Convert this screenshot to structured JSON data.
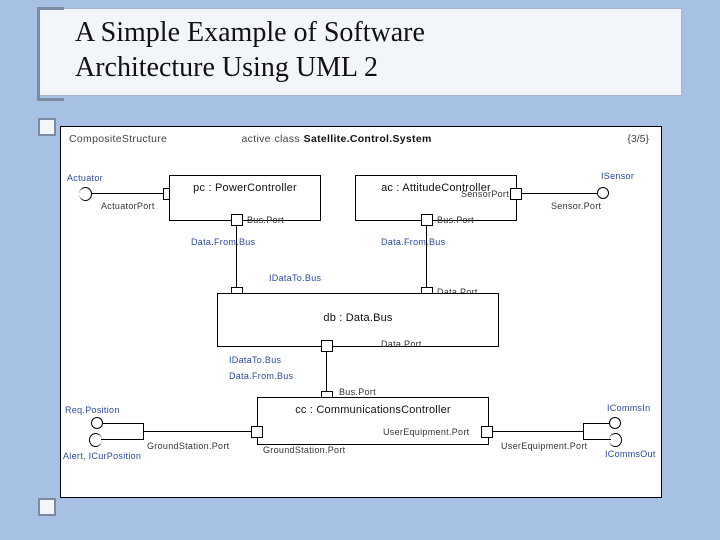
{
  "title_line1": "A Simple Example of Software",
  "title_line2": "Architecture Using UML 2",
  "header": {
    "left": "CompositeStructure",
    "middle_prefix": "active class",
    "middle_class": "Satellite.Control.System",
    "page": "{3/5}"
  },
  "components": {
    "pc": {
      "name": "pc : PowerController"
    },
    "ac": {
      "name": "ac : AttitudeController"
    },
    "db": {
      "name": "db : Data.Bus"
    },
    "cc": {
      "name": "cc : CommunicationsController"
    }
  },
  "labels": {
    "actuator": "Actuator",
    "isensor": "ISensor",
    "actuatorPortL": "ActuatorPort",
    "actuatorPortR": "ActuatorPort",
    "sensorPortL": "SensorPort",
    "sensorPortR": "Sensor.Port",
    "busPort": "Bus.Port",
    "dataFromBus": "Data.From.Bus",
    "idataToBus": "IDataTo.Bus",
    "dataPort": "Data.Port",
    "reqPosition": "Req.Position",
    "alert": "Alert, ICurPosition",
    "groundStationPort": "GroundStation.Port",
    "userEquipmentPort": "UserEquipment.Port",
    "icommsIn": "ICommsIn",
    "icommsOut": "ICommsOut"
  }
}
